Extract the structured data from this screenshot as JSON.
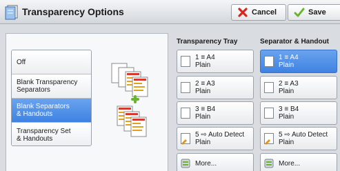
{
  "window": {
    "title": "Transparency Options",
    "cancel_label": "Cancel",
    "save_label": "Save"
  },
  "options": [
    {
      "label": "Off",
      "selected": false
    },
    {
      "label": "Blank Transparency\nSeparators",
      "selected": false
    },
    {
      "label": "Blank Separators\n& Handouts",
      "selected": true
    },
    {
      "label": "Transparency Set\n& Handouts",
      "selected": false
    }
  ],
  "transparency_tray": {
    "heading": "Transparency Tray",
    "trays": [
      {
        "line1": "1 ≡ A4",
        "line2": "Plain",
        "selected": false
      },
      {
        "line1": "2 ≡ A3",
        "line2": "Plain",
        "selected": false
      },
      {
        "line1": "3 ≡ B4",
        "line2": "Plain",
        "selected": false
      },
      {
        "line1": "5 ⇨ Auto Detect",
        "line2": "Plain",
        "selected": false
      }
    ],
    "more_label": "More..."
  },
  "separator_handout": {
    "heading": "Separator & Handout",
    "trays": [
      {
        "line1": "1 ≡ A4",
        "line2": "Plain",
        "selected": true
      },
      {
        "line1": "2 ≡ A3",
        "line2": "Plain",
        "selected": false
      },
      {
        "line1": "3 ≡ B4",
        "line2": "Plain",
        "selected": false
      },
      {
        "line1": "5 ⇨ Auto Detect",
        "line2": "Plain",
        "selected": false
      }
    ],
    "more_label": "More..."
  },
  "colors": {
    "selected": "#4a8ae6",
    "cancel_icon": "#d9241c",
    "save_icon": "#6ab42c"
  }
}
